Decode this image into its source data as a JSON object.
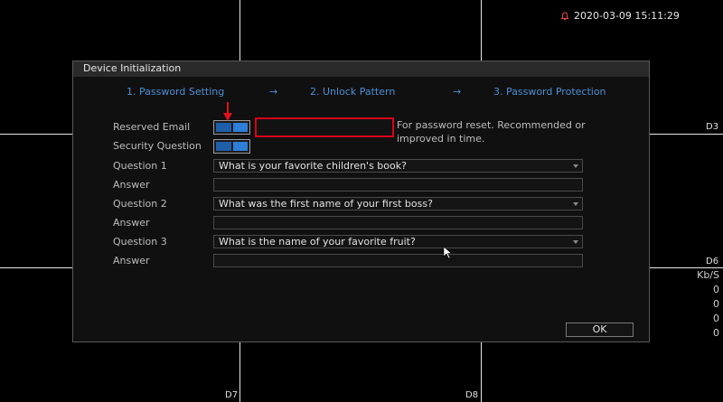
{
  "status": {
    "datetime": "2020-03-09 15:11:29"
  },
  "channels": {
    "d3": "D3",
    "d6": "D6",
    "d7": "D7",
    "d8": "D8"
  },
  "stats": {
    "unit": "Kb/S",
    "values": [
      "0",
      "0",
      "0",
      "0"
    ]
  },
  "dialog": {
    "title": "Device Initialization",
    "steps": [
      "1.  Password Setting",
      "2.  Unlock Pattern",
      "3.  Password Protection"
    ],
    "step_arrow": "→",
    "reserved_email_label": "Reserved Email",
    "reserved_email_enabled": true,
    "email_value": "",
    "email_hint": "For password reset. Recommended or improved in time.",
    "security_question_label": "Security Question",
    "security_question_enabled": true,
    "questions": [
      {
        "label": "Question 1",
        "value": "What is your favorite children's book?",
        "answer_label": "Answer"
      },
      {
        "label": "Question 2",
        "value": "What was the first name of your first boss?",
        "answer_label": "Answer"
      },
      {
        "label": "Question 3",
        "value": "What is the name of your favorite fruit?",
        "answer_label": "Answer"
      }
    ],
    "ok_label": "OK"
  },
  "colors": {
    "accent": "#2d7fd8",
    "step_text": "#4e8fd6",
    "highlight": "#d9001b"
  }
}
